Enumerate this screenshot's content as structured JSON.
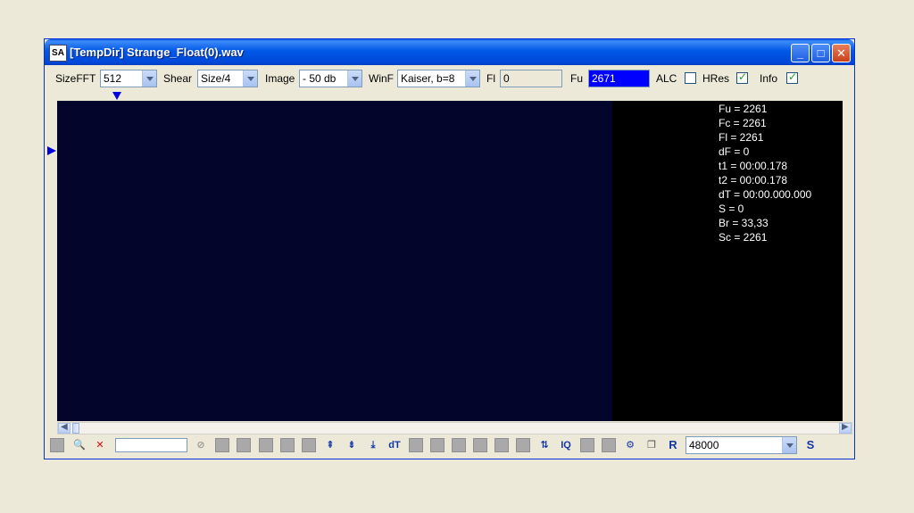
{
  "window": {
    "title": "[TempDir] Strange_Float(0).wav",
    "app_icon_text": "SA"
  },
  "toolbar": {
    "sizefft_label": "SizeFFT",
    "sizefft_value": "512",
    "shear_label": "Shear",
    "shear_value": "Size/4",
    "image_label": "Image",
    "image_value": "- 50 db",
    "winf_label": "WinF",
    "winf_value": "Kaiser, b=8",
    "fl_label": "Fl",
    "fl_value": "0",
    "fu_label": "Fu",
    "fu_value": "2671",
    "alc_label": "ALC",
    "alc_checked": false,
    "hres_label": "HRes",
    "hres_checked": true,
    "info_label": "Info",
    "info_checked": true
  },
  "info_panel": [
    "Fu = 2261",
    "Fc = 2261",
    "Fl = 2261",
    "dF = 0",
    "t1 = 00:00.178",
    "t2 = 00:00.178",
    "dT = 00:00.000.000",
    "S = 0",
    "Br = 33,33",
    "Sc = 2261"
  ],
  "bottombar": {
    "sample_rate_value": "48000",
    "dt_label": "dT",
    "r_label": "R",
    "s_label": "S",
    "iq_label": "IQ"
  },
  "colors": {
    "spectrogram_bg": "#03052a",
    "sweep_core": "#ff1f6a",
    "titlebar": "#0058e6",
    "fu_field": "#0000ff"
  }
}
